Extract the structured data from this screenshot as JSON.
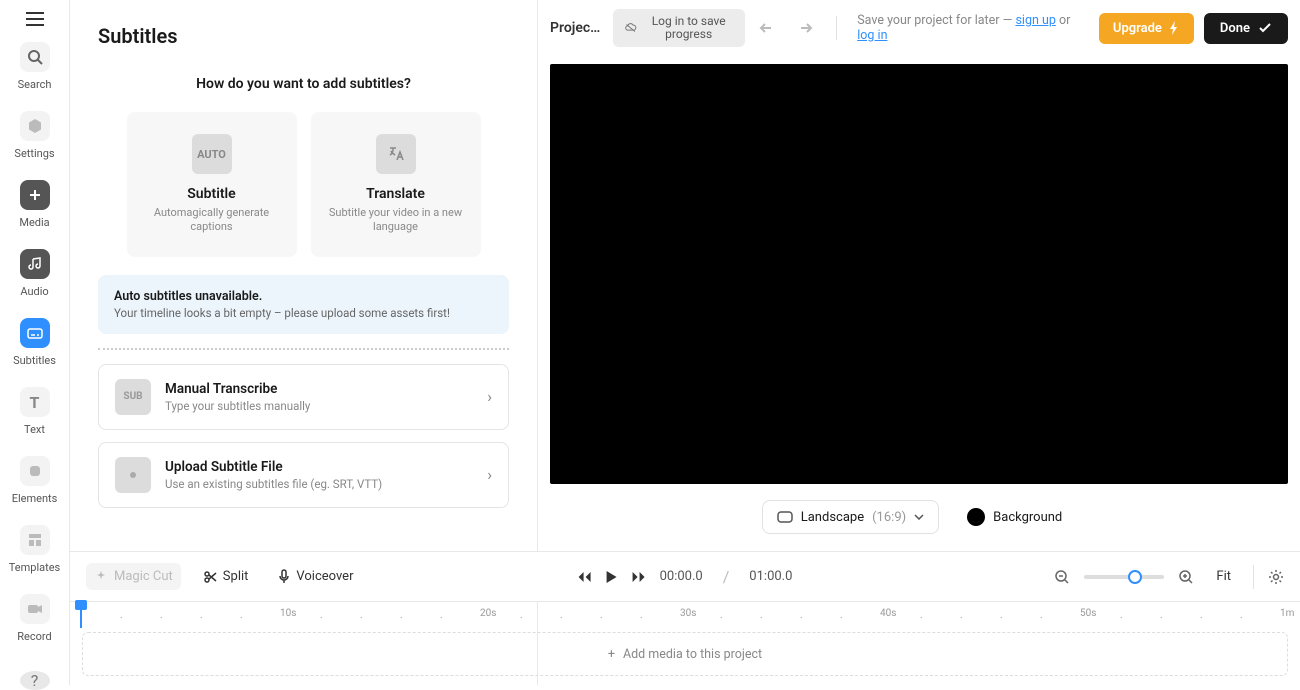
{
  "sidebar": {
    "items": [
      {
        "label": "Search"
      },
      {
        "label": "Settings"
      },
      {
        "label": "Media"
      },
      {
        "label": "Audio"
      },
      {
        "label": "Subtitles"
      },
      {
        "label": "Text"
      },
      {
        "label": "Elements"
      },
      {
        "label": "Templates"
      },
      {
        "label": "Record"
      }
    ]
  },
  "panel": {
    "title": "Subtitles",
    "question": "How do you want to add subtitles?",
    "cards": [
      {
        "icon": "AUTO",
        "title": "Subtitle",
        "sub": "Automagically generate captions"
      },
      {
        "icon": "xA",
        "title": "Translate",
        "sub": "Subtitle your video in a new language"
      }
    ],
    "info": {
      "title": "Auto subtitles unavailable.",
      "text": "Your timeline looks a bit empty – please upload some assets first!"
    },
    "options": [
      {
        "icon": "SUB",
        "title": "Manual Transcribe",
        "sub": "Type your subtitles manually"
      },
      {
        "icon": "•",
        "title": "Upload Subtitle File",
        "sub": "Use an existing subtitles file (eg. SRT, VTT)"
      }
    ]
  },
  "topbar": {
    "project": "Project...",
    "login_save": "Log in to save progress",
    "save_prefix": "Save your project for later — ",
    "signup": "sign up",
    "or": " or ",
    "login": "log in",
    "upgrade": "Upgrade",
    "done": "Done"
  },
  "preview": {
    "size_label": "Landscape",
    "ratio": "(16:9)",
    "bg_label": "Background"
  },
  "toolbar": {
    "magic_cut": "Magic Cut",
    "split": "Split",
    "voiceover": "Voiceover",
    "current": "00:00.0",
    "total": "01:00.0",
    "fit": "Fit"
  },
  "timeline": {
    "marks": [
      "10s",
      "20s",
      "30s",
      "40s",
      "50s",
      "1m"
    ],
    "empty": "Add media to this project"
  }
}
